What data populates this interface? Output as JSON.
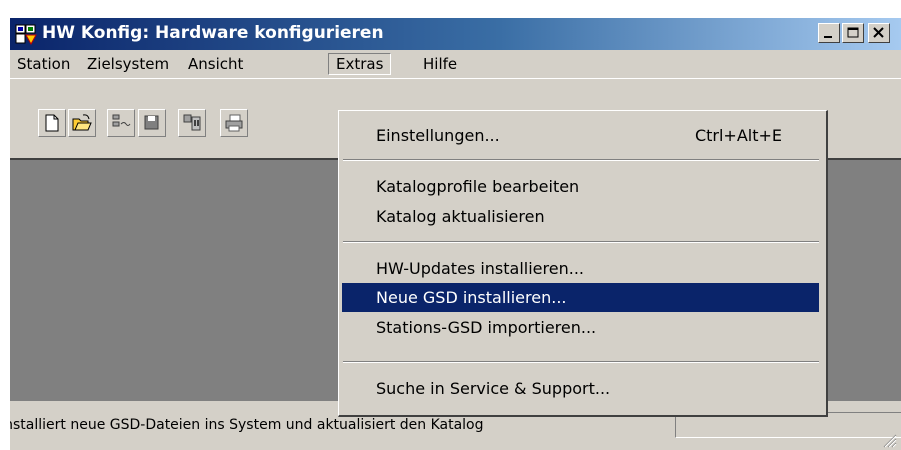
{
  "window": {
    "title": "HW Konfig: Hardware konfigurieren",
    "app_icon": "hw-config-icon",
    "controls": {
      "minimize_icon": "minimize-icon",
      "maximize_icon": "maximize-icon",
      "close_icon": "close-icon"
    }
  },
  "menubar": {
    "items": [
      {
        "label": "Station"
      },
      {
        "label": "Zielsystem"
      },
      {
        "label": "Ansicht"
      },
      {
        "label": "Extras",
        "open": true
      },
      {
        "label": "Hilfe"
      }
    ]
  },
  "toolbar": {
    "icons": [
      "new-icon",
      "open-icon",
      "network-icon",
      "save-icon",
      "compile-icon",
      "print-icon"
    ]
  },
  "extras_menu": {
    "items": [
      {
        "label": "Einstellungen...",
        "shortcut": "Ctrl+Alt+E"
      },
      {
        "label": "Katalogprofile bearbeiten"
      },
      {
        "label": "Katalog aktualisieren"
      },
      {
        "label": "HW-Updates installieren..."
      },
      {
        "label": "Neue GSD installieren...",
        "highlighted": true
      },
      {
        "label": "Stations-GSD importieren..."
      },
      {
        "label": "Suche in Service & Support..."
      }
    ]
  },
  "statusbar": {
    "text": "Installiert neue GSD-Dateien ins System und aktualisiert den Katalog"
  },
  "colors": {
    "face": "#d4d0c8",
    "title_start": "#0a246a",
    "title_end": "#a6caf0",
    "highlight": "#0a246a",
    "workarea": "#808080"
  }
}
